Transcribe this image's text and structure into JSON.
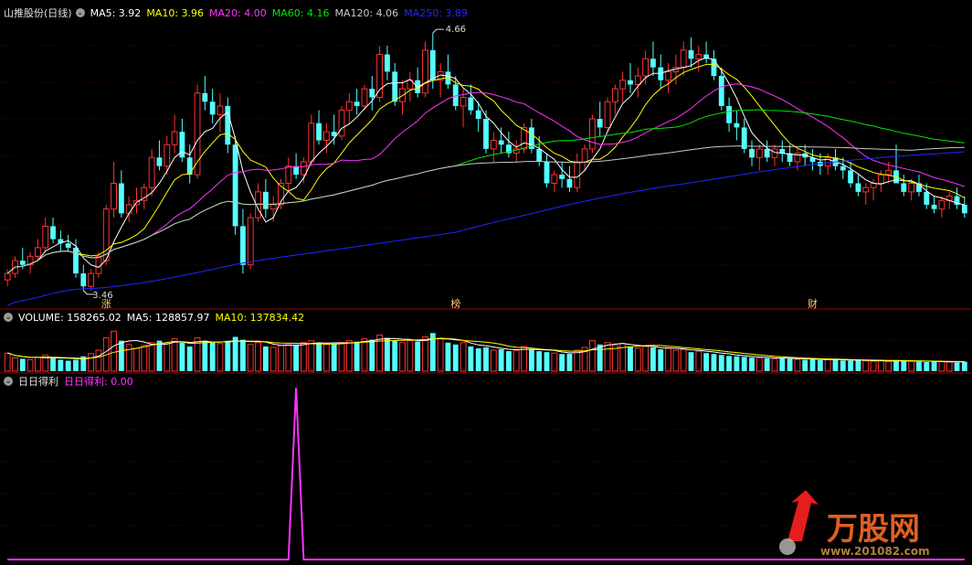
{
  "colors": {
    "up": "#ff3232",
    "down": "#54ffff",
    "ma5": "#ffffff",
    "ma10": "#ffff00",
    "ma20": "#ff33ff",
    "ma60": "#00e600",
    "ma120": "#c8c8c8",
    "ma250": "#1e28ff",
    "indicator": "#ff33ff",
    "grid": "#5a0000",
    "watermark_red": "#ff2020",
    "watermark_text": "#e06020"
  },
  "price_panel": {
    "title": "山推股份(日线)",
    "ma_labels": [
      {
        "key": "ma5",
        "text": "MA5: 3.92"
      },
      {
        "key": "ma10",
        "text": "MA10: 3.96"
      },
      {
        "key": "ma20",
        "text": "MA20: 4.00"
      },
      {
        "key": "ma60",
        "text": "MA60: 4.16"
      },
      {
        "key": "ma120",
        "text": "MA120: 4.06"
      },
      {
        "key": "ma250",
        "text": "MA250: 3.89"
      }
    ],
    "high_label": "4.66",
    "low_label": "3.46",
    "markers": [
      {
        "text": "涨",
        "index": 13
      },
      {
        "text": "榜",
        "index": 59
      },
      {
        "text": "财",
        "index": 106
      }
    ]
  },
  "volume_panel": {
    "labels": [
      {
        "key": "ma5",
        "text": "VOLUME: 158265.02",
        "color_key": "ma5"
      },
      {
        "key": "vma5",
        "text": "MA5: 128857.97",
        "color_key": "ma5"
      },
      {
        "key": "vma10",
        "text": "MA10: 137834.42",
        "color_key": "ma10"
      }
    ]
  },
  "indicator_panel": {
    "name": "日日得利",
    "value_label": "日日得利: 0.00"
  },
  "watermark": {
    "text": "万股网",
    "url": "www.201082.com"
  },
  "chart_data": {
    "type": "candlestick",
    "symbol": "山推股份",
    "period": "日线",
    "price_range": [
      3.4,
      4.72
    ],
    "candles": [
      [
        3.51,
        3.56,
        3.48,
        3.54
      ],
      [
        3.54,
        3.62,
        3.52,
        3.6
      ],
      [
        3.6,
        3.66,
        3.56,
        3.58
      ],
      [
        3.58,
        3.64,
        3.54,
        3.62
      ],
      [
        3.62,
        3.7,
        3.6,
        3.66
      ],
      [
        3.66,
        3.8,
        3.64,
        3.76
      ],
      [
        3.76,
        3.8,
        3.68,
        3.7
      ],
      [
        3.7,
        3.74,
        3.64,
        3.68
      ],
      [
        3.68,
        3.72,
        3.64,
        3.66
      ],
      [
        3.66,
        3.7,
        3.52,
        3.54
      ],
      [
        3.54,
        3.58,
        3.46,
        3.48
      ],
      [
        3.48,
        3.56,
        3.46,
        3.54
      ],
      [
        3.54,
        3.64,
        3.52,
        3.62
      ],
      [
        3.6,
        3.86,
        3.58,
        3.84
      ],
      [
        3.84,
        4.06,
        3.8,
        3.96
      ],
      [
        3.96,
        4.02,
        3.8,
        3.82
      ],
      [
        3.82,
        3.9,
        3.78,
        3.86
      ],
      [
        3.86,
        3.94,
        3.82,
        3.88
      ],
      [
        3.88,
        3.96,
        3.84,
        3.94
      ],
      [
        3.94,
        4.12,
        3.9,
        4.08
      ],
      [
        4.08,
        4.16,
        4.02,
        4.04
      ],
      [
        4.04,
        4.18,
        4.0,
        4.14
      ],
      [
        4.14,
        4.28,
        4.1,
        4.2
      ],
      [
        4.2,
        4.26,
        4.06,
        4.08
      ],
      [
        4.08,
        4.14,
        3.96,
        4.0
      ],
      [
        4.0,
        4.42,
        3.98,
        4.38
      ],
      [
        4.38,
        4.46,
        4.3,
        4.34
      ],
      [
        4.34,
        4.4,
        4.24,
        4.28
      ],
      [
        4.28,
        4.38,
        4.2,
        4.32
      ],
      [
        4.32,
        4.36,
        4.1,
        4.14
      ],
      [
        4.14,
        4.18,
        3.72,
        3.76
      ],
      [
        3.76,
        3.84,
        3.54,
        3.58
      ],
      [
        3.58,
        3.82,
        3.56,
        3.8
      ],
      [
        3.8,
        3.96,
        3.78,
        3.92
      ],
      [
        3.92,
        3.98,
        3.8,
        3.84
      ],
      [
        3.84,
        3.9,
        3.78,
        3.86
      ],
      [
        3.86,
        3.98,
        3.84,
        3.96
      ],
      [
        3.96,
        4.08,
        3.92,
        4.04
      ],
      [
        4.04,
        4.1,
        3.98,
        4.0
      ],
      [
        4.0,
        4.08,
        3.96,
        4.06
      ],
      [
        4.06,
        4.28,
        4.04,
        4.24
      ],
      [
        4.24,
        4.3,
        4.14,
        4.16
      ],
      [
        4.16,
        4.24,
        4.1,
        4.2
      ],
      [
        4.2,
        4.28,
        4.14,
        4.18
      ],
      [
        4.18,
        4.32,
        4.16,
        4.3
      ],
      [
        4.3,
        4.38,
        4.24,
        4.34
      ],
      [
        4.34,
        4.4,
        4.28,
        4.32
      ],
      [
        4.32,
        4.42,
        4.3,
        4.4
      ],
      [
        4.4,
        4.46,
        4.3,
        4.36
      ],
      [
        4.36,
        4.6,
        4.34,
        4.56
      ],
      [
        4.56,
        4.6,
        4.44,
        4.48
      ],
      [
        4.48,
        4.52,
        4.32,
        4.34
      ],
      [
        4.34,
        4.44,
        4.28,
        4.4
      ],
      [
        4.4,
        4.48,
        4.34,
        4.44
      ],
      [
        4.44,
        4.5,
        4.36,
        4.38
      ],
      [
        4.38,
        4.62,
        4.36,
        4.58
      ],
      [
        4.58,
        4.66,
        4.4,
        4.44
      ],
      [
        4.44,
        4.52,
        4.36,
        4.48
      ],
      [
        4.48,
        4.56,
        4.4,
        4.42
      ],
      [
        4.42,
        4.46,
        4.3,
        4.32
      ],
      [
        4.32,
        4.4,
        4.22,
        4.36
      ],
      [
        4.36,
        4.42,
        4.28,
        4.3
      ],
      [
        4.3,
        4.34,
        4.2,
        4.26
      ],
      [
        4.26,
        4.3,
        4.1,
        4.12
      ],
      [
        4.12,
        4.2,
        4.06,
        4.16
      ],
      [
        4.16,
        4.22,
        4.1,
        4.14
      ],
      [
        4.14,
        4.2,
        4.08,
        4.1
      ],
      [
        4.1,
        4.16,
        4.06,
        4.12
      ],
      [
        4.12,
        4.24,
        4.1,
        4.22
      ],
      [
        4.22,
        4.26,
        4.1,
        4.12
      ],
      [
        4.12,
        4.18,
        4.04,
        4.06
      ],
      [
        4.06,
        4.1,
        3.94,
        3.96
      ],
      [
        3.96,
        4.02,
        3.92,
        4.0
      ],
      [
        4.0,
        4.06,
        3.94,
        3.98
      ],
      [
        3.98,
        4.04,
        3.92,
        3.94
      ],
      [
        3.94,
        4.1,
        3.92,
        4.06
      ],
      [
        4.06,
        4.14,
        4.02,
        4.12
      ],
      [
        4.12,
        4.28,
        4.1,
        4.26
      ],
      [
        4.26,
        4.34,
        4.18,
        4.22
      ],
      [
        4.22,
        4.36,
        4.2,
        4.34
      ],
      [
        4.34,
        4.42,
        4.28,
        4.4
      ],
      [
        4.4,
        4.48,
        4.34,
        4.44
      ],
      [
        4.44,
        4.52,
        4.38,
        4.42
      ],
      [
        4.42,
        4.5,
        4.36,
        4.46
      ],
      [
        4.46,
        4.58,
        4.42,
        4.54
      ],
      [
        4.54,
        4.62,
        4.46,
        4.5
      ],
      [
        4.5,
        4.56,
        4.4,
        4.44
      ],
      [
        4.44,
        4.52,
        4.38,
        4.48
      ],
      [
        4.48,
        4.56,
        4.42,
        4.5
      ],
      [
        4.5,
        4.62,
        4.46,
        4.58
      ],
      [
        4.58,
        4.64,
        4.5,
        4.54
      ],
      [
        4.54,
        4.6,
        4.48,
        4.56
      ],
      [
        4.56,
        4.62,
        4.52,
        4.54
      ],
      [
        4.54,
        4.58,
        4.44,
        4.46
      ],
      [
        4.46,
        4.5,
        4.3,
        4.32
      ],
      [
        4.32,
        4.36,
        4.2,
        4.24
      ],
      [
        4.24,
        4.3,
        4.16,
        4.22
      ],
      [
        4.22,
        4.26,
        4.1,
        4.12
      ],
      [
        4.12,
        4.16,
        4.04,
        4.08
      ],
      [
        4.08,
        4.14,
        4.02,
        4.12
      ],
      [
        4.12,
        4.16,
        4.06,
        4.08
      ],
      [
        4.08,
        4.14,
        4.04,
        4.12
      ],
      [
        4.12,
        4.16,
        4.06,
        4.1
      ],
      [
        4.1,
        4.14,
        4.04,
        4.06
      ],
      [
        4.06,
        4.12,
        4.02,
        4.1
      ],
      [
        4.1,
        4.14,
        4.04,
        4.08
      ],
      [
        4.08,
        4.12,
        4.02,
        4.06
      ],
      [
        4.06,
        4.1,
        4.0,
        4.04
      ],
      [
        4.04,
        4.1,
        4.0,
        4.08
      ],
      [
        4.08,
        4.12,
        4.02,
        4.04
      ],
      [
        4.04,
        4.08,
        3.98,
        4.02
      ],
      [
        4.02,
        4.06,
        3.94,
        3.96
      ],
      [
        3.96,
        4.0,
        3.9,
        3.92
      ],
      [
        3.92,
        3.96,
        3.86,
        3.94
      ],
      [
        3.94,
        3.98,
        3.88,
        3.96
      ],
      [
        3.96,
        4.02,
        3.92,
        4.0
      ],
      [
        4.0,
        4.06,
        3.96,
        4.02
      ],
      [
        4.02,
        4.14,
        4.0,
        3.96
      ],
      [
        3.96,
        4.0,
        3.9,
        3.92
      ],
      [
        3.92,
        3.98,
        3.88,
        3.96
      ],
      [
        3.96,
        4.0,
        3.9,
        3.92
      ],
      [
        3.92,
        3.96,
        3.84,
        3.86
      ],
      [
        3.86,
        3.9,
        3.82,
        3.84
      ],
      [
        3.84,
        3.9,
        3.8,
        3.88
      ],
      [
        3.88,
        3.92,
        3.84,
        3.9
      ],
      [
        3.9,
        3.94,
        3.84,
        3.86
      ],
      [
        3.86,
        3.9,
        3.8,
        3.82
      ]
    ],
    "volume": [
      95,
      70,
      65,
      60,
      72,
      85,
      68,
      60,
      55,
      60,
      78,
      92,
      110,
      175,
      210,
      160,
      140,
      120,
      135,
      150,
      160,
      145,
      170,
      150,
      130,
      175,
      160,
      150,
      145,
      155,
      180,
      165,
      140,
      150,
      130,
      125,
      135,
      145,
      140,
      150,
      160,
      150,
      140,
      145,
      150,
      160,
      155,
      170,
      165,
      190,
      175,
      160,
      150,
      160,
      155,
      180,
      200,
      170,
      150,
      140,
      150,
      130,
      120,
      125,
      110,
      115,
      105,
      110,
      130,
      115,
      105,
      100,
      95,
      90,
      92,
      110,
      125,
      160,
      140,
      150,
      135,
      145,
      130,
      120,
      130,
      125,
      115,
      120,
      110,
      115,
      100,
      105,
      95,
      90,
      85,
      80,
      78,
      75,
      72,
      70,
      68,
      65,
      70,
      66,
      62,
      60,
      64,
      58,
      60,
      62,
      56,
      55,
      58,
      54,
      52,
      55,
      50,
      58,
      56,
      52,
      50,
      48,
      52,
      50,
      48,
      46,
      50
    ],
    "volume_range": [
      0,
      240
    ],
    "indicator": {
      "name": "日日得利",
      "spike_index": 38,
      "spike_value": 1.0,
      "baseline": 0.0
    }
  }
}
